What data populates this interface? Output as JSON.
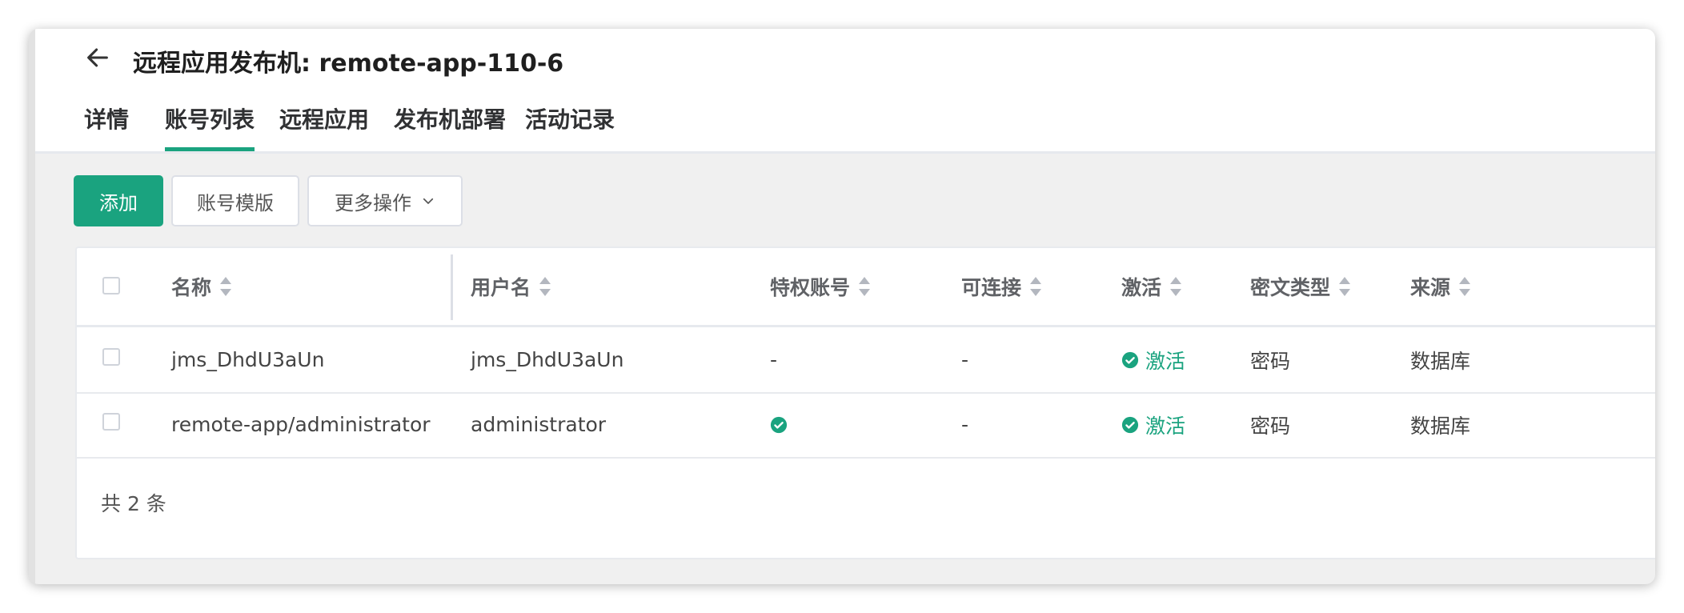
{
  "header": {
    "title": "远程应用发布机: remote-app-110-6",
    "back_icon": "arrow-left-icon"
  },
  "tabs": [
    {
      "label": "详情",
      "active": false
    },
    {
      "label": "账号列表",
      "active": true
    },
    {
      "label": "远程应用",
      "active": false
    },
    {
      "label": "发布机部署",
      "active": false
    },
    {
      "label": "活动记录",
      "active": false
    }
  ],
  "toolbar": {
    "add_label": "添加",
    "template_label": "账号模版",
    "more_label": "更多操作"
  },
  "table": {
    "columns": [
      "名称",
      "用户名",
      "特权账号",
      "可连接",
      "激活",
      "密文类型",
      "来源"
    ],
    "rows": [
      {
        "name": "jms_DhdU3aUn",
        "username": "jms_DhdU3aUn",
        "privileged": "-",
        "connectable": "-",
        "active": "激活",
        "secret_type": "密码",
        "source": "数据库"
      },
      {
        "name": "remote-app/administrator",
        "username": "administrator",
        "privileged": "",
        "connectable": "-",
        "active": "激活",
        "secret_type": "密码",
        "source": "数据库"
      }
    ],
    "total": "共 2 条"
  },
  "colors": {
    "accent": "#1aa37f",
    "text": "#303133"
  }
}
